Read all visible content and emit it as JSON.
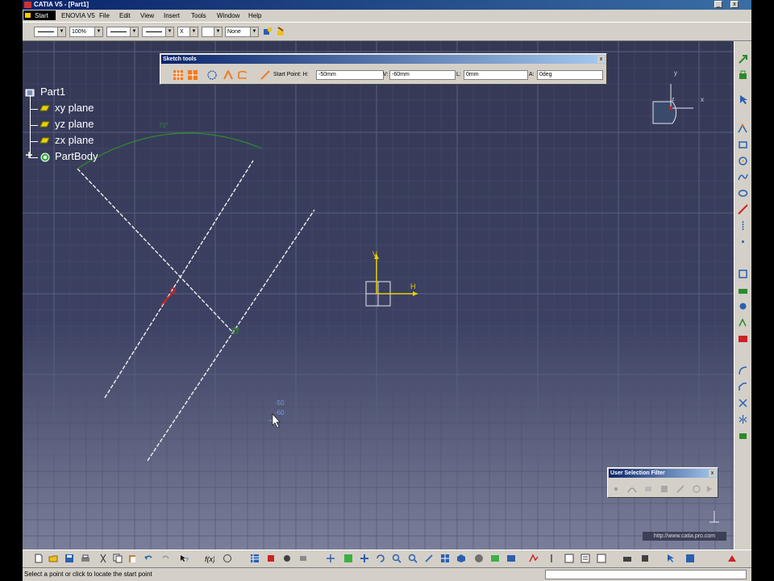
{
  "window": {
    "title": "CATIA V5 - [Part1]",
    "min": "_",
    "close": "x"
  },
  "menu": {
    "start": "Start",
    "items": [
      "ENOVIA V5",
      "File",
      "Edit",
      "View",
      "Insert",
      "Tools",
      "Window",
      "Help"
    ]
  },
  "toolbar": {
    "zoom": "100%",
    "cross": "X",
    "none": "None"
  },
  "tree": {
    "root": "Part1",
    "xy": "xy plane",
    "yz": "yz plane",
    "zx": "zx plane",
    "body": "PartBody"
  },
  "sketch_tools": {
    "title": "Sketch tools",
    "start_point_h_label": "Start Point: H:",
    "start_point_h": "-50mm",
    "v_label": "V:",
    "v": "-60mm",
    "l_label": "L:",
    "l": "0mm",
    "a_label": "A:",
    "a": "0deg",
    "close": "x"
  },
  "selection_filter": {
    "title": "User Selection Filter",
    "close": "x"
  },
  "canvas": {
    "angle_dim": "70°",
    "axis_h": "H",
    "axis_v": "V",
    "readout_h": "-50",
    "readout_v": "-60",
    "compass_x": "x",
    "compass_y": "y",
    "compass_z": "z",
    "point_mark": "30"
  },
  "watermark": "http://www.catia.pro.com",
  "status": {
    "message": "Select a point or click to locate the start point"
  },
  "colors": {
    "viewport_top": "#343854",
    "title_blue": "#0a246a",
    "axis_yellow": "#e8d200",
    "arc_green": "#2e8b2e",
    "constraint_red": "#cc2222"
  }
}
